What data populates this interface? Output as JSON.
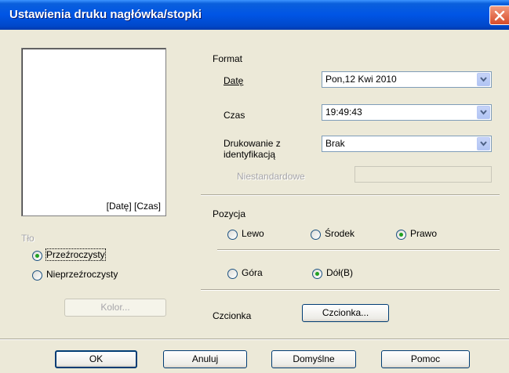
{
  "window": {
    "title": "Ustawienia druku nagłówka/stopki"
  },
  "preview": {
    "label": "[Datę] [Czas]"
  },
  "background": {
    "heading": "Tło",
    "options": [
      {
        "label": "Przeźroczysty",
        "checked": true
      },
      {
        "label": "Nieprzeźroczysty",
        "checked": false
      }
    ],
    "color_button": "Kolor..."
  },
  "format": {
    "heading": "Format",
    "date_label": "Datę",
    "date_value": "Pon,12 Kwi 2010",
    "time_label": "Czas",
    "time_value": "19:49:43",
    "id_label_line1": "Drukowanie z",
    "id_label_line2": "identyfikacją",
    "id_value": "Brak",
    "custom_label": "Niestandardowe",
    "custom_value": ""
  },
  "position": {
    "heading": "Pozycja",
    "horizontal": [
      {
        "label": "Lewo",
        "checked": false
      },
      {
        "label": "Środek",
        "checked": false
      },
      {
        "label": "Prawo",
        "checked": true
      }
    ],
    "vertical": [
      {
        "label": "Góra",
        "checked": false
      },
      {
        "label": "Dół(B)",
        "checked": true
      }
    ]
  },
  "font": {
    "label": "Czcionka",
    "button": "Czcionka..."
  },
  "footer": {
    "ok": "OK",
    "cancel": "Anuluj",
    "default": "Domyślne",
    "help": "Pomoc"
  }
}
